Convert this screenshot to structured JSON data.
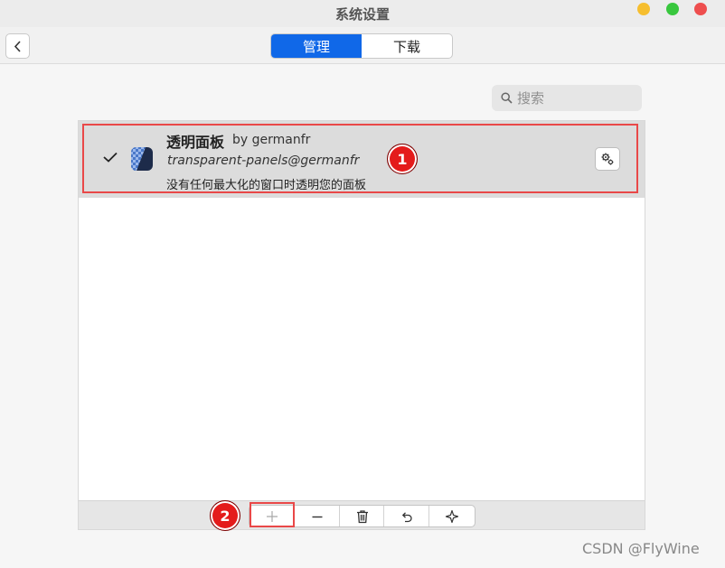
{
  "window": {
    "title": "系统设置"
  },
  "toolbar": {
    "tabs": [
      {
        "label": "管理",
        "active": true
      },
      {
        "label": "下载",
        "active": false
      }
    ]
  },
  "search": {
    "placeholder": "搜索",
    "value": ""
  },
  "extensions": [
    {
      "enabled": true,
      "name": "透明面板",
      "author": "by germanfr",
      "uuid": "transparent-panels@germanfr",
      "description": "没有任何最大化的窗口时透明您的面板"
    }
  ],
  "annotations": {
    "badge_1": "1",
    "badge_2": "2"
  },
  "bottom_toolbar": {
    "buttons": [
      "add-icon",
      "remove-icon",
      "trash-icon",
      "undo-icon",
      "sparkle-icon"
    ]
  },
  "watermark": "CSDN @FlyWine",
  "colors": {
    "accent": "#1068e8",
    "highlight": "#e94848",
    "badge": "#e41b1b",
    "selected_row": "#dcdcdc"
  }
}
